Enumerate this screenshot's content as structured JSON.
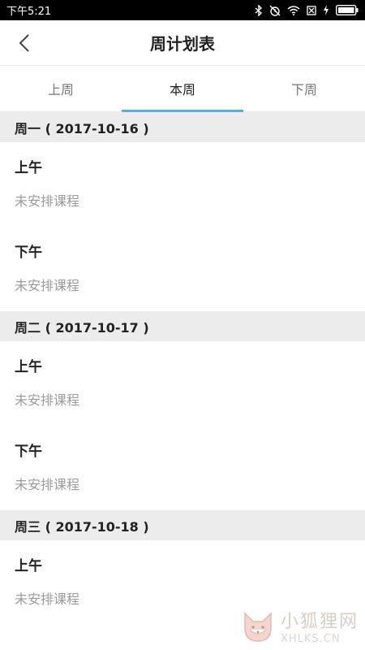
{
  "status_bar": {
    "time": "下午5:21",
    "icons": [
      "bluetooth-icon",
      "alarm-off-icon",
      "wifi-icon",
      "sim-off-icon",
      "charging-icon",
      "battery-icon"
    ]
  },
  "navbar": {
    "back_icon": "chevron-left-icon",
    "title": "周计划表"
  },
  "tabs": [
    {
      "label": "上周",
      "active": false
    },
    {
      "label": "本周",
      "active": true
    },
    {
      "label": "下周",
      "active": false
    }
  ],
  "colors": {
    "accent": "#5ab0d8",
    "section_bg": "#ececec",
    "muted_text": "#9a9a9a"
  },
  "days": [
    {
      "header": "周一 ( 2017-10-16 )",
      "periods": [
        {
          "label": "上午",
          "status": "未安排课程"
        },
        {
          "label": "下午",
          "status": "未安排课程"
        }
      ]
    },
    {
      "header": "周二 ( 2017-10-17 )",
      "periods": [
        {
          "label": "上午",
          "status": "未安排课程"
        },
        {
          "label": "下午",
          "status": "未安排课程"
        }
      ]
    },
    {
      "header": "周三 ( 2017-10-18 )",
      "periods": [
        {
          "label": "上午",
          "status": "未安排课程"
        }
      ]
    }
  ],
  "watermark": {
    "cn": "小狐狸网",
    "en": "XHLKS.CN"
  }
}
